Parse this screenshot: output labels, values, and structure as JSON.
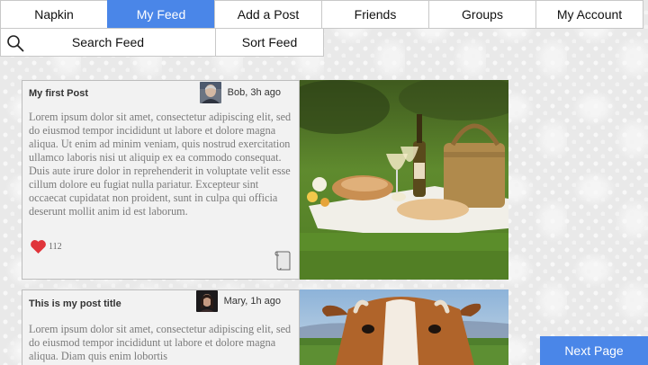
{
  "nav": {
    "items": [
      {
        "label": "Napkin",
        "active": false
      },
      {
        "label": "My Feed",
        "active": true
      },
      {
        "label": "Add a Post",
        "active": false
      },
      {
        "label": "Friends",
        "active": false
      },
      {
        "label": "Groups",
        "active": false
      },
      {
        "label": "My Account",
        "active": false
      }
    ]
  },
  "toolbar": {
    "search_label": "Search Feed",
    "sort_label": "Sort Feed"
  },
  "posts": [
    {
      "title": "My first Post",
      "author": "Bob, 3h ago",
      "body": "Lorem ipsum dolor sit amet, consectetur adipiscing elit, sed do eiusmod tempor incididunt ut labore et dolore magna aliqua. Ut enim ad minim veniam, quis nostrud exercitation ullamco laboris nisi ut aliquip ex ea commodo consequat. Duis aute irure dolor in reprehenderit in voluptate velit esse cillum dolore eu fugiat nulla pariatur. Excepteur sint occaecat cupidatat non proident, sunt in culpa qui officia deserunt mollit anim id est laborum.",
      "likes": "112",
      "image": "picnic-photo"
    },
    {
      "title": "This is my post title",
      "author": "Mary, 1h ago",
      "body": "Lorem ipsum dolor sit amet, consectetur adipiscing elit, sed do eiusmod tempor incididunt ut labore et dolore magna aliqua. Diam quis enim lobortis",
      "image": "cow-photo"
    }
  ],
  "next_label": "Next Page",
  "colors": {
    "accent": "#4a86e8",
    "heart": "#e0343a"
  }
}
